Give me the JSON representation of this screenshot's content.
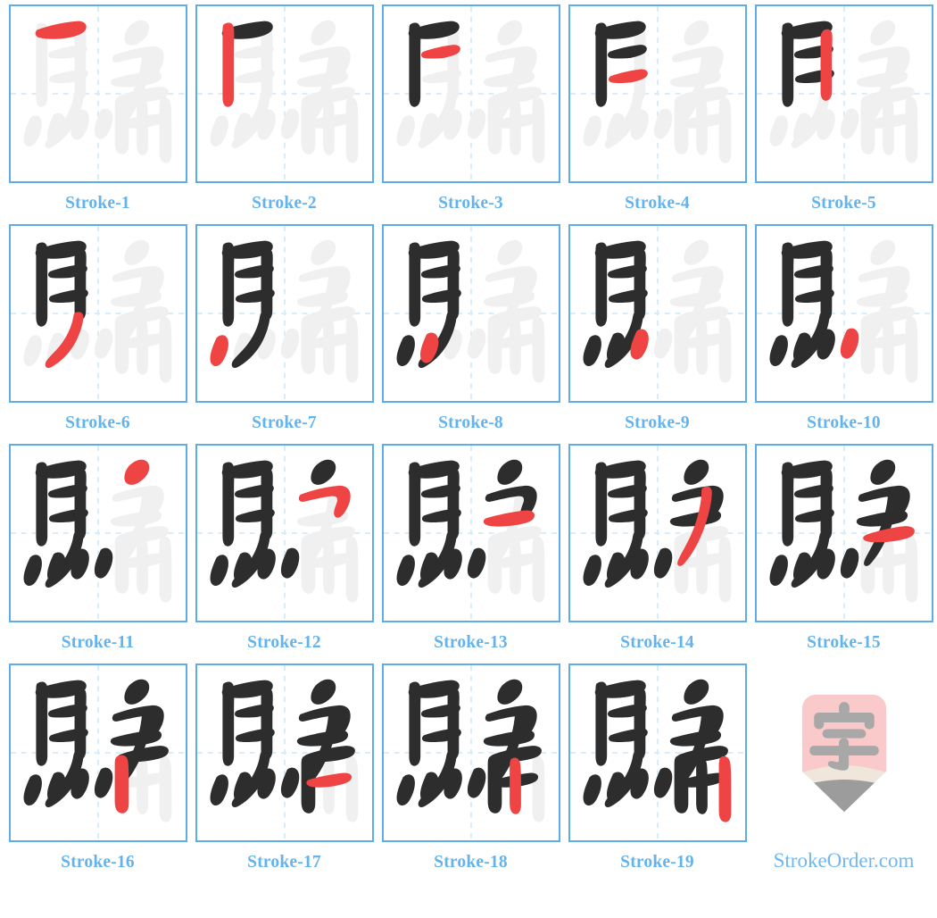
{
  "page": {
    "character": "騙",
    "total_strokes": 19,
    "columns": 5,
    "rows": 4
  },
  "colors": {
    "cell_border": "#5CADEA",
    "guide_line": "#D8ECF9",
    "ghost_stroke": "#F0F0F0",
    "done_stroke": "#2D2D2D",
    "current_stroke": "#EE4444",
    "label_text": "#64B3EC",
    "brand_text": "#6FB8EE",
    "logo_body": "#FAC9C9",
    "logo_band": "#EFE7DC",
    "logo_tip": "#9C9C9C",
    "logo_glyph": "#A8A8A8",
    "background": "#FFFFFF"
  },
  "cells": [
    {
      "label": "Stroke-1",
      "index": 1
    },
    {
      "label": "Stroke-2",
      "index": 2
    },
    {
      "label": "Stroke-3",
      "index": 3
    },
    {
      "label": "Stroke-4",
      "index": 4
    },
    {
      "label": "Stroke-5",
      "index": 5
    },
    {
      "label": "Stroke-6",
      "index": 6
    },
    {
      "label": "Stroke-7",
      "index": 7
    },
    {
      "label": "Stroke-8",
      "index": 8
    },
    {
      "label": "Stroke-9",
      "index": 9
    },
    {
      "label": "Stroke-10",
      "index": 10
    },
    {
      "label": "Stroke-11",
      "index": 11
    },
    {
      "label": "Stroke-12",
      "index": 12
    },
    {
      "label": "Stroke-13",
      "index": 13
    },
    {
      "label": "Stroke-14",
      "index": 14
    },
    {
      "label": "Stroke-15",
      "index": 15
    },
    {
      "label": "Stroke-16",
      "index": 16
    },
    {
      "label": "Stroke-17",
      "index": 17
    },
    {
      "label": "Stroke-18",
      "index": 18
    },
    {
      "label": "Stroke-19",
      "index": 19
    }
  ],
  "logo": {
    "glyph": "字",
    "brand_text": "StrokeOrder.com",
    "icon_name": "pencil-logo"
  },
  "stroke_paths": [
    "M30 27 C44 22 62 18 77 17 C84 17 88 21 86 26 C84 31 76 34 66 36 C54 38 42 38 33 36 C28 35 27 30 30 27 Z",
    "M30 21 C34 18 39 18 41 22 C43 27 42 36 42 49 L42 104 C42 111 39 115 35 115 C31 115 29 111 29 104 L29 32 C29 26 29 23 30 21 Z",
    "M45 52 C56 48 70 45 80 44 C86 44 89 47 87 51 C85 55 78 57 69 59 C59 60 50 60 46 59 C42 58 42 54 45 52 Z",
    "M46 80 C57 76 71 73 81 72 C87 72 90 75 88 79 C86 83 79 85 70 87 C60 88 51 88 47 87 C43 86 43 82 46 80 Z",
    "M76 28 C80 25 85 26 86 31 C87 36 86 45 86 57 L86 97 C86 104 83 108 79 108 C75 108 73 104 73 97 L73 38 C73 32 74 30 76 28 Z",
    "M74 99 C80 97 84 100 83 106 C82 114 79 124 73 135 C66 147 56 156 47 161 C42 164 38 161 40 156 C42 151 50 145 57 136 C64 127 69 116 71 107 C72 102 72 100 74 99 Z",
    "M22 128 C27 123 33 124 35 130 C37 137 34 147 29 155 C25 161 19 162 16 157 C13 151 16 141 22 128 Z",
    "M49 124 C54 120 60 122 62 128 C64 135 61 145 56 152 C52 158 46 158 43 153 C40 147 43 137 49 124 Z",
    "M76 120 C81 116 87 118 89 124 C91 131 88 141 83 148 C79 154 73 154 70 149 C67 143 70 133 76 120 Z",
    "M103 119 C108 115 114 117 116 123 C118 130 115 140 110 147 C106 153 100 153 97 148 C94 142 97 132 103 119 Z",
    "M139 20 C147 14 156 15 158 22 C160 30 154 38 145 43 C137 47 130 44 130 37 C130 31 133 24 139 20 Z",
    "M118 56 C131 51 148 47 160 46 C168 45 174 48 175 55 C176 62 173 70 168 77 C164 83 159 84 157 80 C155 76 158 70 160 64 C161 59 159 57 152 58 C143 59 131 62 122 64 C117 65 114 61 118 56 Z",
    "M117 83 C131 79 150 75 163 74 C170 74 174 77 172 82 C170 87 162 89 150 91 C137 93 124 93 118 91 C113 89 113 85 117 83 Z",
    "M152 48 C157 45 162 47 162 54 C162 63 159 77 154 92 C148 109 140 124 131 134 C126 140 121 138 123 132 C125 126 133 114 139 100 C145 86 149 70 150 57 C150 51 150 49 152 48 Z",
    "M125 102 C139 97 158 93 170 92 C178 92 182 95 180 100 C178 105 170 107 158 109 C144 111 130 111 125 109 C120 107 121 104 125 102 Z",
    "M122 104 C127 101 133 103 134 109 C135 115 135 126 135 137 L135 158 C135 166 131 170 126 169 C121 168 119 163 119 155 L119 116 C119 109 119 106 122 104 Z",
    "M127 131 C140 127 157 124 168 123 C175 123 178 126 176 130 C174 134 167 136 157 138 C145 140 132 140 128 138 C124 136 124 133 127 131 Z",
    "M146 107 C150 104 155 106 156 112 C157 118 157 128 157 140 L157 160 C157 167 154 171 150 170 C146 169 144 165 144 157 L144 119 C144 112 144 109 146 107 Z",
    "M172 105 C177 102 182 105 183 112 C184 119 184 133 184 148 L184 169 C184 176 181 180 176 179 C172 178 170 174 170 166 L170 120 C170 112 170 108 172 105 Z"
  ]
}
